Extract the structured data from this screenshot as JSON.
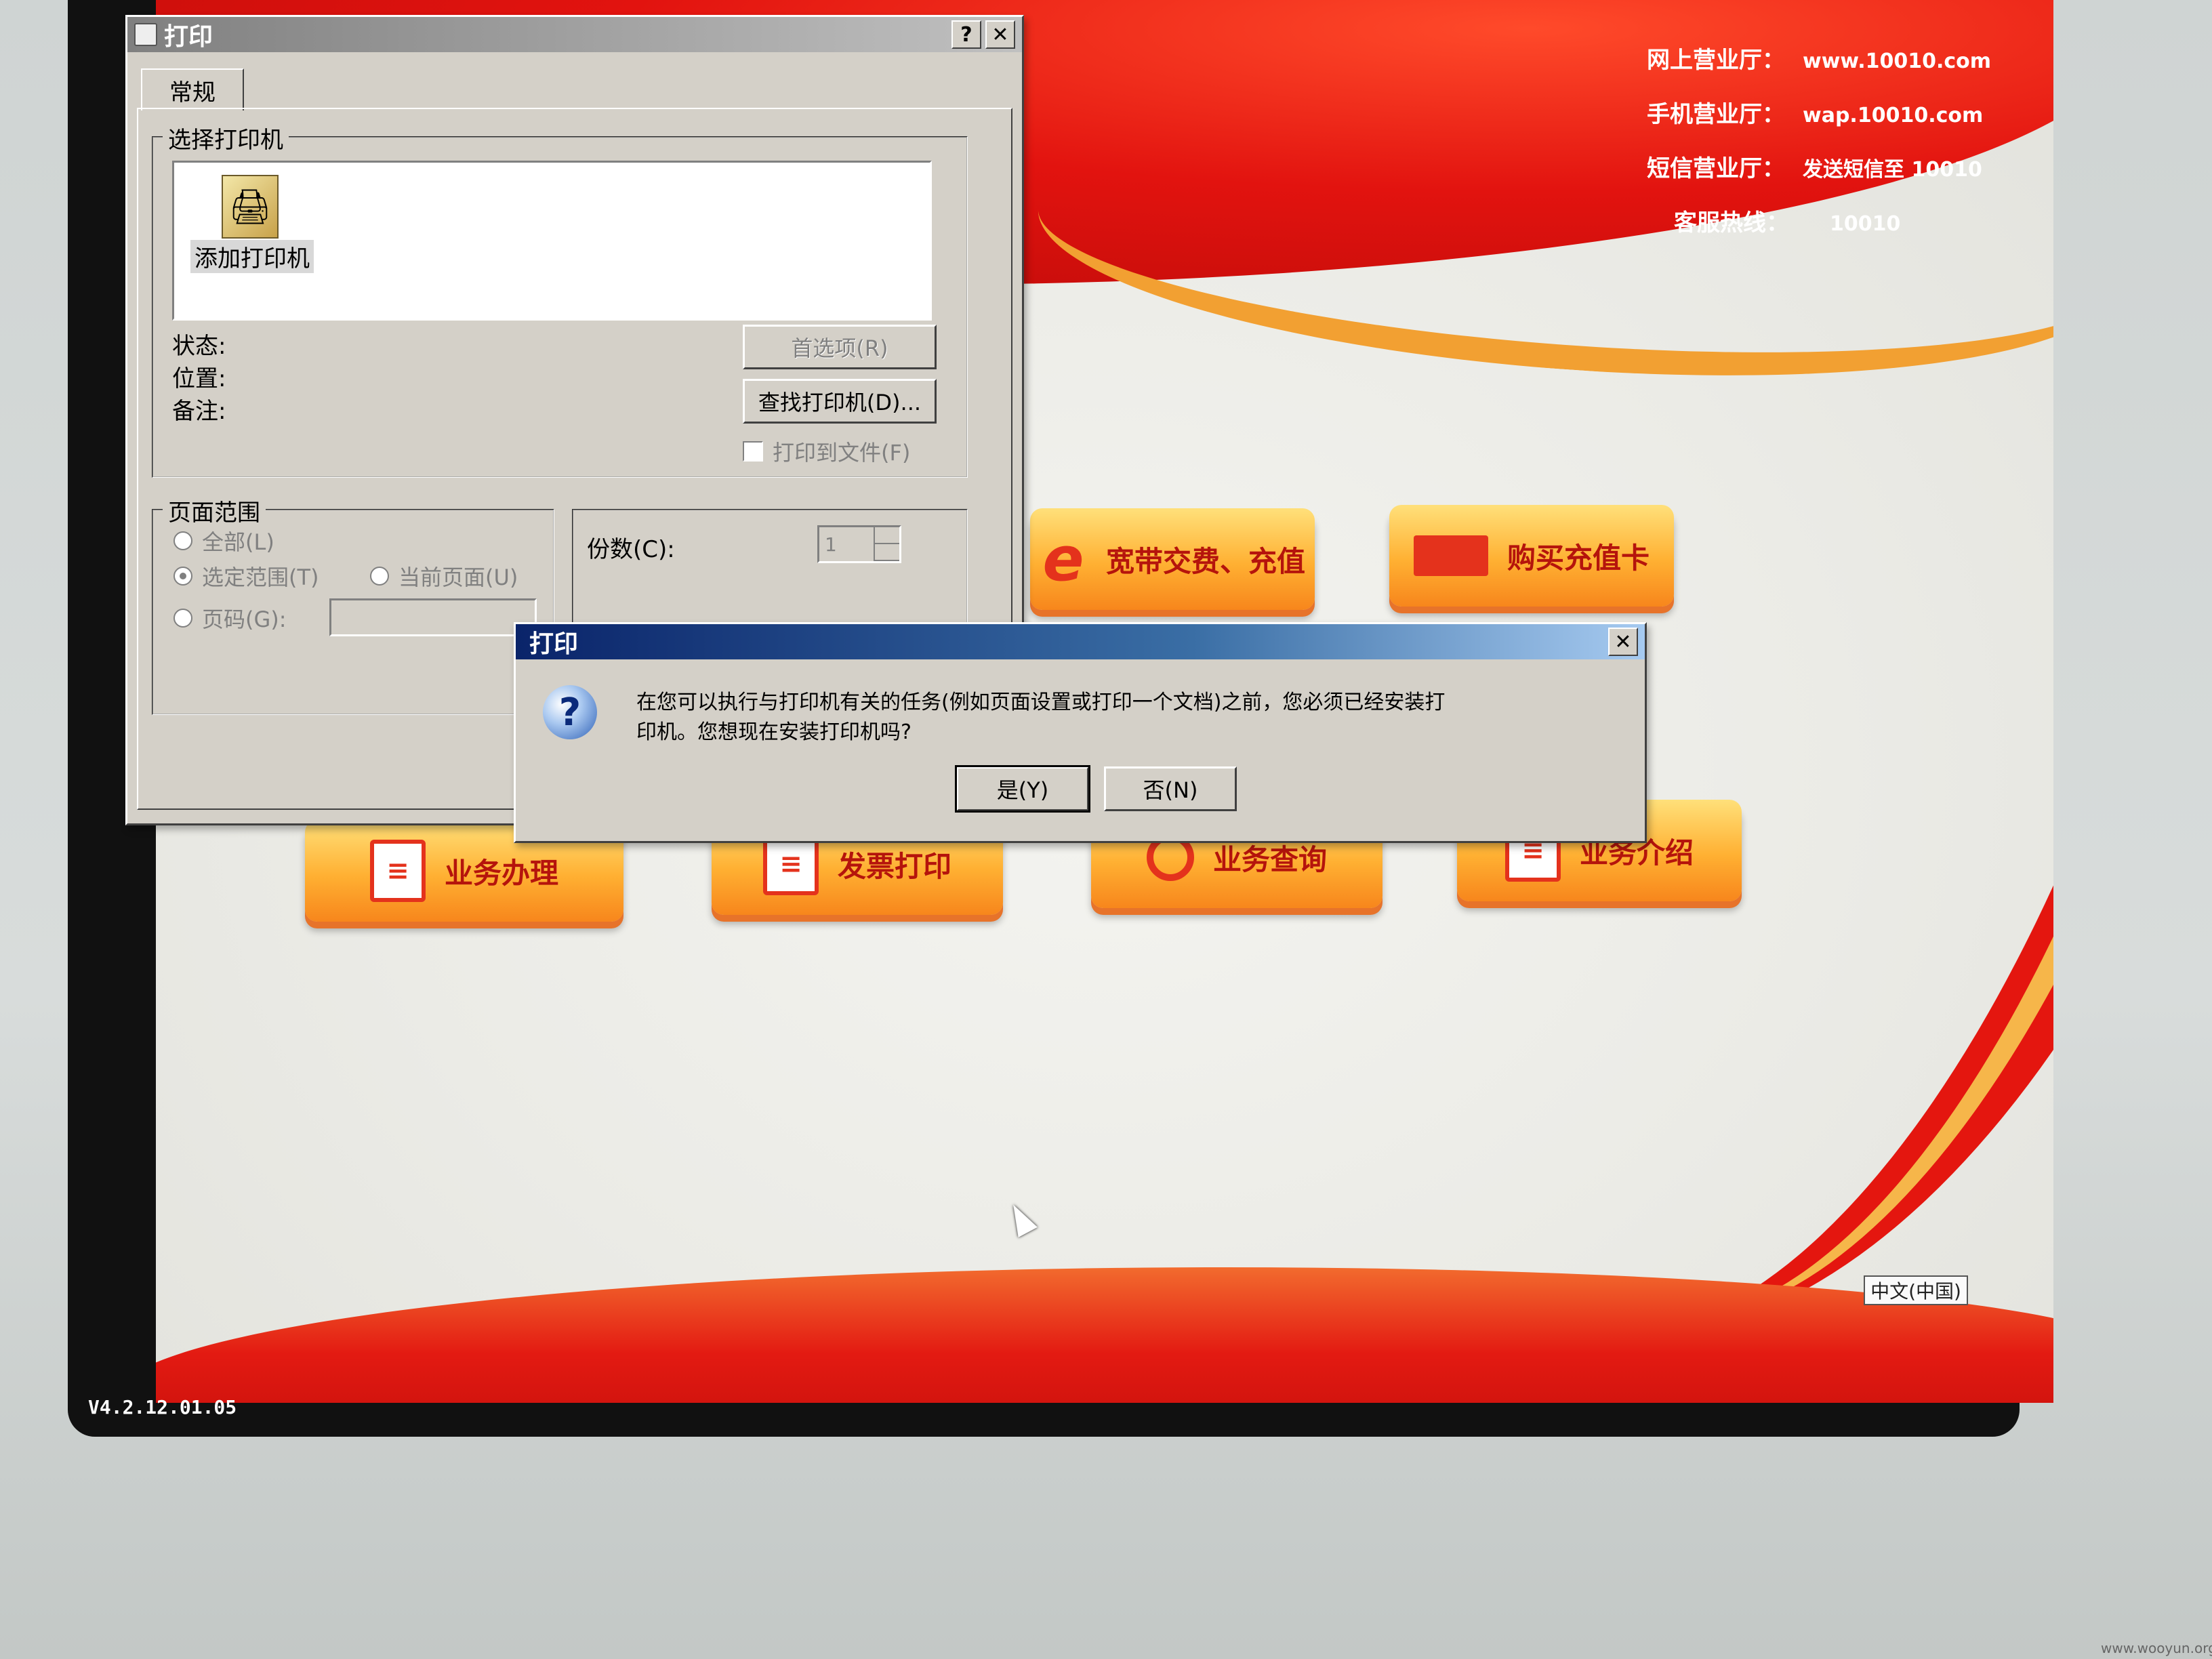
{
  "kiosk": {
    "contact": [
      {
        "label": "网上营业厅：",
        "value": "www.10010.com"
      },
      {
        "label": "手机营业厅：",
        "value": "wap.10010.com"
      },
      {
        "label": "短信营业厅：",
        "value": "发送短信至 10010"
      }
    ],
    "hotline": {
      "label": "客服热线：",
      "value": "10010"
    },
    "tiles": {
      "broadband": "宽带交费、充值",
      "buy_card": "购买充值卡",
      "business": "业务办理",
      "invoice": "发票打印",
      "query": "业务查询",
      "intro": "业务介绍"
    },
    "version": "V4.2.12.01.05",
    "language": "中文(中国)"
  },
  "print_dialog": {
    "title": "打印",
    "help_glyph": "?",
    "close_glyph": "✕",
    "tab": "常规",
    "select_printer_group": "选择打印机",
    "add_printer_label": "添加打印机",
    "status_label": "状态:",
    "location_label": "位置:",
    "comment_label": "备注:",
    "preferences_button": "首选项(R)",
    "find_printer_button": "查找打印机(D)...",
    "print_to_file_label": "打印到文件(F)",
    "page_range_group": "页面范围",
    "all_label": "全部(L)",
    "selection_label": "选定范围(T)",
    "current_page_label": "当前页面(U)",
    "pages_label": "页码(G):",
    "copies_label": "份数(C):",
    "copies_value": "1"
  },
  "message_box": {
    "title": "打印",
    "close_glyph": "✕",
    "icon_glyph": "?",
    "message": "在您可以执行与打印机有关的任务(例如页面设置或打印一个文档)之前，您必须已经安装打印机。您想现在安装打印机吗?",
    "yes_button": "是(Y)",
    "no_button": "否(N)"
  },
  "watermark": "www.wooyun.org",
  "colors": {
    "brand_red": "#e2130f",
    "tile_orange": "#ffb032",
    "dialog_gray": "#d4d0c8",
    "active_title": "#0a246a"
  }
}
